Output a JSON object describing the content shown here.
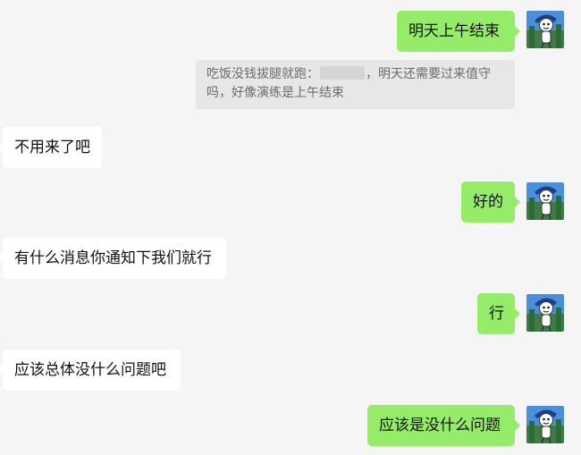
{
  "messages": [
    {
      "text": "明天上午结束"
    },
    {
      "text": "不用来了吧"
    },
    {
      "text": "好的"
    },
    {
      "text": "有什么消息你通知下我们就行"
    },
    {
      "text": "行"
    },
    {
      "text": "应该总体没什么问题吧"
    },
    {
      "text": "应该是没什么问题"
    }
  ],
  "quote": {
    "sender": "吃饭没钱拔腿就跑：",
    "text_after_redaction": "，明天还需要过来值守",
    "line2": "吗，好像演练是上午结束"
  },
  "colors": {
    "background": "#f5f5f5",
    "self_bubble": "#95ec69",
    "other_bubble": "#ffffff",
    "quote_bg": "#e7e7e7",
    "quote_text": "#6b6b6b"
  },
  "icons": {
    "avatar": "cartoon-character-avatar-icon"
  }
}
